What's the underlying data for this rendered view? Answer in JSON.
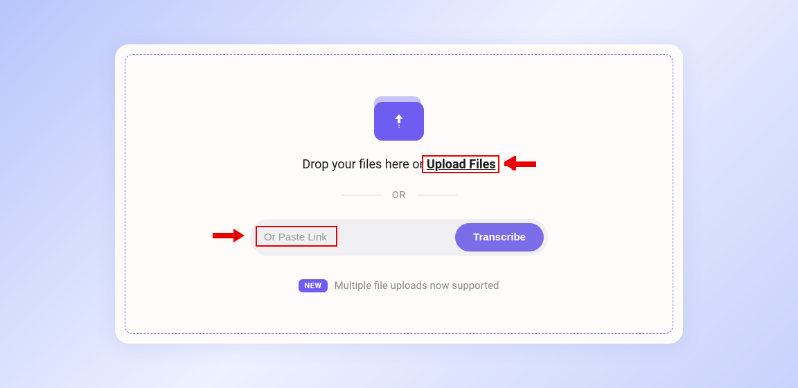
{
  "dropzone": {
    "prompt_prefix": "Drop your files here or ",
    "upload_link_label": "Upload Files"
  },
  "divider": {
    "label": "OR"
  },
  "link_input": {
    "placeholder": "Or Paste Link",
    "button_label": "Transcribe"
  },
  "footer": {
    "badge": "NEW",
    "message": "Multiple file uploads now supported"
  }
}
